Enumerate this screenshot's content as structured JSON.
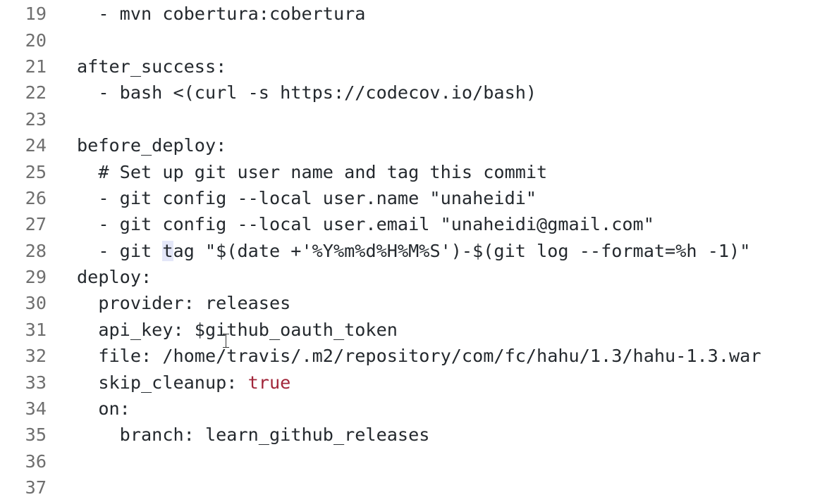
{
  "editor": {
    "lines": [
      {
        "num": "19",
        "text": "  - mvn cobertura:cobertura"
      },
      {
        "num": "20",
        "text": ""
      },
      {
        "num": "21",
        "text": "after_success:"
      },
      {
        "num": "22",
        "text": "  - bash <(curl -s https://codecov.io/bash)"
      },
      {
        "num": "23",
        "text": ""
      },
      {
        "num": "24",
        "text": "before_deploy:"
      },
      {
        "num": "25",
        "text": "  # Set up git user name and tag this commit"
      },
      {
        "num": "26",
        "text": "  - git config --local user.name \"unaheidi\""
      },
      {
        "num": "27",
        "text": "  - git config --local user.email \"unaheidi@gmail.com\""
      },
      {
        "num": "28a",
        "text": "  - git "
      },
      {
        "num": "28b",
        "text": "t"
      },
      {
        "num": "28c",
        "text": "ag \"$(date +'%Y%m%d%H%M%S')-$(git log --format=%h -1)\""
      },
      {
        "num": "29",
        "text": "deploy:"
      },
      {
        "num": "30",
        "text": "  provider: releases"
      },
      {
        "num": "31",
        "text": "  api_key: $github_oauth_token"
      },
      {
        "num": "32",
        "text": "  file: /home/travis/.m2/repository/com/fc/hahu/1.3/hahu-1.3.war"
      },
      {
        "num": "33a",
        "text": "  skip_cleanup: "
      },
      {
        "num": "33b",
        "text": "true"
      },
      {
        "num": "34",
        "text": "  on:"
      },
      {
        "num": "35",
        "text": "    branch: learn_github_releases"
      },
      {
        "num": "36",
        "text": ""
      },
      {
        "num": "37",
        "text": ""
      }
    ],
    "line_numbers": [
      "19",
      "20",
      "21",
      "22",
      "23",
      "24",
      "25",
      "26",
      "27",
      "28",
      "29",
      "30",
      "31",
      "32",
      "33",
      "34",
      "35",
      "36",
      "37"
    ]
  }
}
